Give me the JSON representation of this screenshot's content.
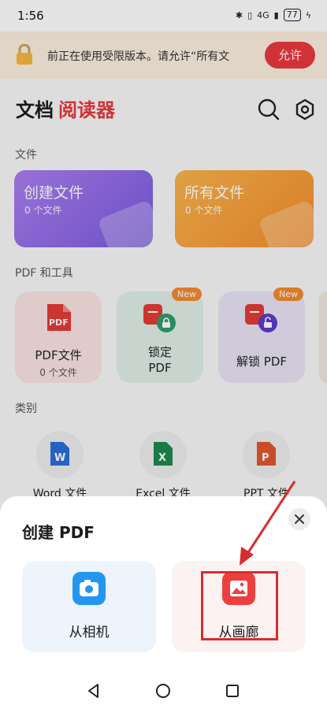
{
  "status_bar": {
    "time": "1:56",
    "network": "4G",
    "battery": "77"
  },
  "banner": {
    "text": "前正在使用受限版本。请允许“所有文",
    "allow_label": "允许"
  },
  "header": {
    "title_main": "文档",
    "title_accent": "阅读器"
  },
  "sections": {
    "files": "文件",
    "pdf_tools": "PDF 和工具",
    "categories": "类别"
  },
  "file_cards": [
    {
      "title": "创建文件",
      "count": "0 个文件"
    },
    {
      "title": "所有文件",
      "count": "0 个文件"
    }
  ],
  "tools": [
    {
      "label": "PDF文件",
      "sub": "0 个文件",
      "icon_text": "PDF"
    },
    {
      "label_line1": "锁定",
      "label_line2": "PDF",
      "badge": "New"
    },
    {
      "label": "解锁 PDF",
      "badge": "New"
    }
  ],
  "categories": [
    {
      "label": "Word 文件",
      "icon_letter": "W"
    },
    {
      "label": "Excel 文件",
      "icon_letter": "X"
    },
    {
      "label": "PPT 文件",
      "icon_letter": "P"
    }
  ],
  "sheet": {
    "title": "创建 PDF",
    "options": [
      {
        "label": "从相机"
      },
      {
        "label": "从画廊"
      }
    ]
  },
  "colors": {
    "accent": "#e8383d",
    "banner_bg": "#fbeede",
    "highlight": "#d62d2d"
  }
}
